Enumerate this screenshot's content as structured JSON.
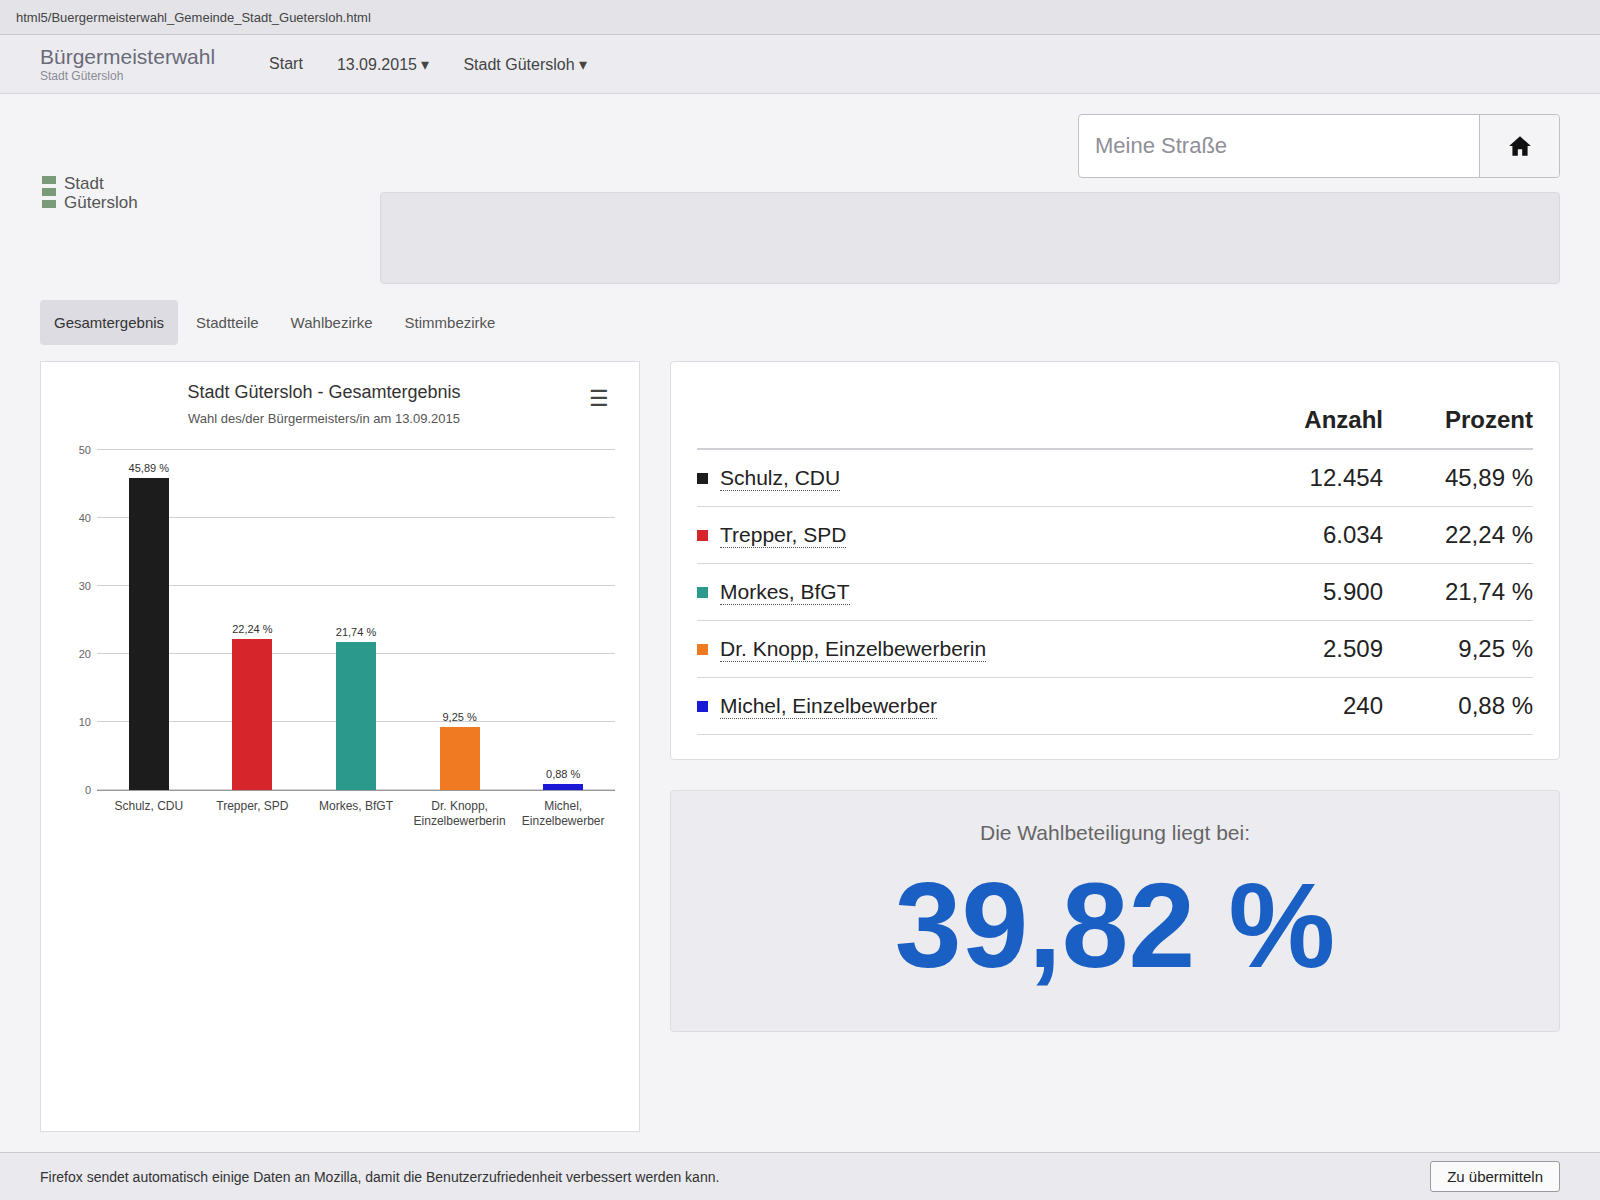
{
  "address_bar": {
    "url": "html5/Buergermeisterwahl_Gemeinde_Stadt_Guetersloh.html"
  },
  "navbar": {
    "brand": "Bürgermeisterwahl",
    "brand_sub": "Stadt Gütersloh",
    "items": [
      {
        "label": "Start",
        "caret": ""
      },
      {
        "label": "13.09.2015",
        "caret": "▾"
      },
      {
        "label": "Stadt Gütersloh",
        "caret": "▾"
      }
    ]
  },
  "logo": {
    "line1": "Stadt",
    "line2": "Gütersloh"
  },
  "search": {
    "placeholder": "Meine Straße"
  },
  "tabs": [
    {
      "label": "Gesamtergebnis",
      "selected": true
    },
    {
      "label": "Stadtteile",
      "selected": false
    },
    {
      "label": "Wahlbezirke",
      "selected": false
    },
    {
      "label": "Stimmbezirke",
      "selected": false
    }
  ],
  "chart": {
    "title": "Stadt Gütersloh - Gesamtergebnis",
    "subtitle": "Wahl des/der Bürgermeisters/in am 13.09.2015",
    "menu": "☰",
    "y_max": 50,
    "y_ticks": [
      "0",
      "10",
      "20",
      "30",
      "40",
      "50"
    ],
    "bars": [
      {
        "category": "Schulz, CDU",
        "value": 45.89,
        "value_label": "45,89 %",
        "color": "#1c1c1c"
      },
      {
        "category": "Trepper, SPD",
        "value": 22.24,
        "value_label": "22,24 %",
        "color": "#d7262b"
      },
      {
        "category": "Morkes, BfGT",
        "value": 21.74,
        "value_label": "21,74 %",
        "color": "#2b9a8c"
      },
      {
        "category": "Dr. Knopp, Einzelbewerberin",
        "value": 9.25,
        "value_label": "9,25 %",
        "color": "#f07a22"
      },
      {
        "category": "Michel, Einzelbewerber",
        "value": 0.88,
        "value_label": "0,88 %",
        "color": "#1a1ad6"
      }
    ]
  },
  "table": {
    "columns": [
      "Anzahl",
      "Prozent"
    ],
    "rows": [
      {
        "name": "Schulz, CDU",
        "count": "12.454",
        "percent": "45,89 %",
        "color": "#1c1c1c"
      },
      {
        "name": "Trepper, SPD",
        "count": "6.034",
        "percent": "22,24 %",
        "color": "#d7262b"
      },
      {
        "name": "Morkes, BfGT",
        "count": "5.900",
        "percent": "21,74 %",
        "color": "#2b9a8c"
      },
      {
        "name": "Dr. Knopp, Einzelbewerberin",
        "count": "2.509",
        "percent": "9,25 %",
        "color": "#f07a22"
      },
      {
        "name": "Michel, Einzelbewerber",
        "count": "240",
        "percent": "0,88 %",
        "color": "#1a1ad6"
      }
    ]
  },
  "turnout": {
    "label": "Die Wahlbeteiligung liegt bei:",
    "value": "39,82 %"
  },
  "notification": {
    "text": "Firefox sendet automatisch einige Daten an Mozilla, damit die Benutzerzufriedenheit verbessert werden kann.",
    "button": "Zu übermitteln"
  }
}
